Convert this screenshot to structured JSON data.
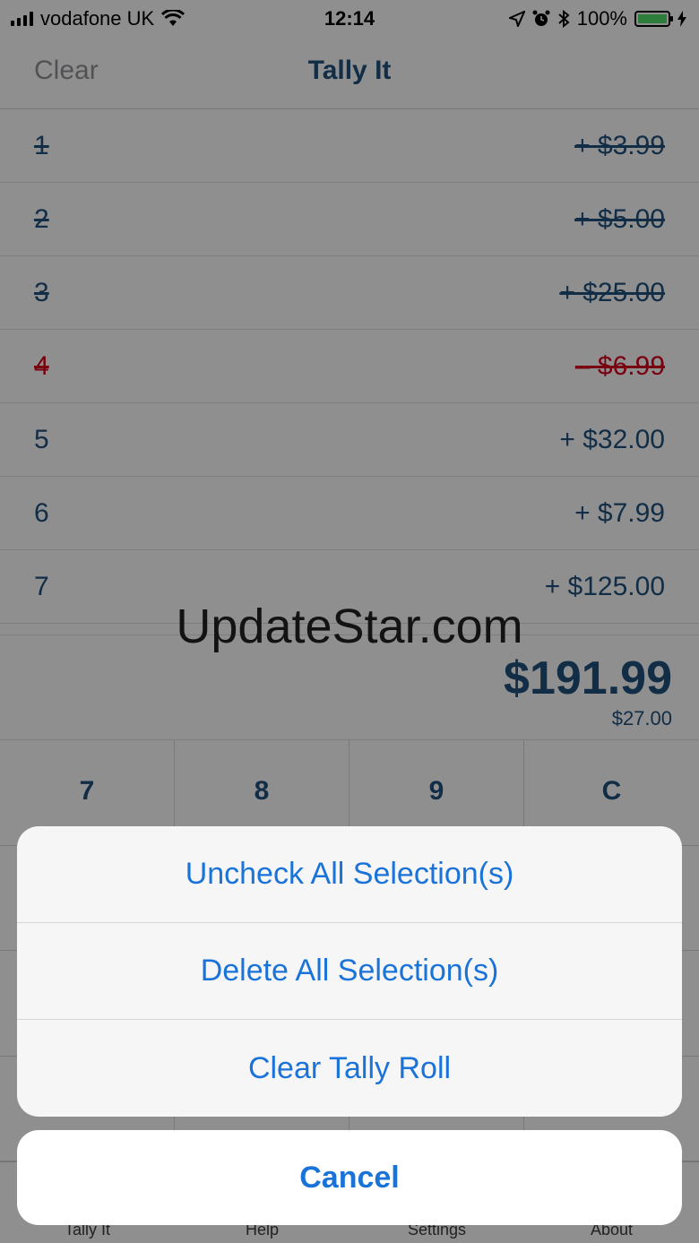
{
  "status_bar": {
    "carrier": "vodafone UK",
    "time": "12:14",
    "battery": "100%",
    "icons": [
      "signal-icon",
      "wifi-icon",
      "location-icon",
      "alarm-icon",
      "bluetooth-icon",
      "battery-icon",
      "charging-icon"
    ]
  },
  "nav": {
    "left_label": "Clear",
    "title": "Tally It"
  },
  "tally": {
    "rows": [
      {
        "num": "1",
        "amount": "+ $3.99",
        "struck": true,
        "negative": false
      },
      {
        "num": "2",
        "amount": "+ $5.00",
        "struck": true,
        "negative": false
      },
      {
        "num": "3",
        "amount": "+ $25.00",
        "struck": true,
        "negative": false
      },
      {
        "num": "4",
        "amount": "– $6.99",
        "struck": true,
        "negative": true
      },
      {
        "num": "5",
        "amount": "+ $32.00",
        "struck": false,
        "negative": false
      },
      {
        "num": "6",
        "amount": "+ $7.99",
        "struck": false,
        "negative": false
      },
      {
        "num": "7",
        "amount": "+ $125.00",
        "struck": false,
        "negative": false
      }
    ]
  },
  "watermark": "UpdateStar.com",
  "totals": {
    "total": "$191.99",
    "subtotal": "$27.00"
  },
  "keypad": {
    "keys": [
      "7",
      "8",
      "9",
      "C",
      "",
      "",
      "",
      "",
      "",
      "",
      "",
      "",
      "",
      "",
      "",
      ""
    ]
  },
  "tabs": [
    "Tally It",
    "Help",
    "Settings",
    "About"
  ],
  "action_sheet": {
    "options": [
      "Uncheck All Selection(s)",
      "Delete All Selection(s)",
      "Clear Tally Roll"
    ],
    "cancel": "Cancel"
  },
  "colors": {
    "accent": "#1a73d9",
    "text_primary": "#1f4e79",
    "negative": "#d0021b",
    "battery": "#4cd964"
  }
}
